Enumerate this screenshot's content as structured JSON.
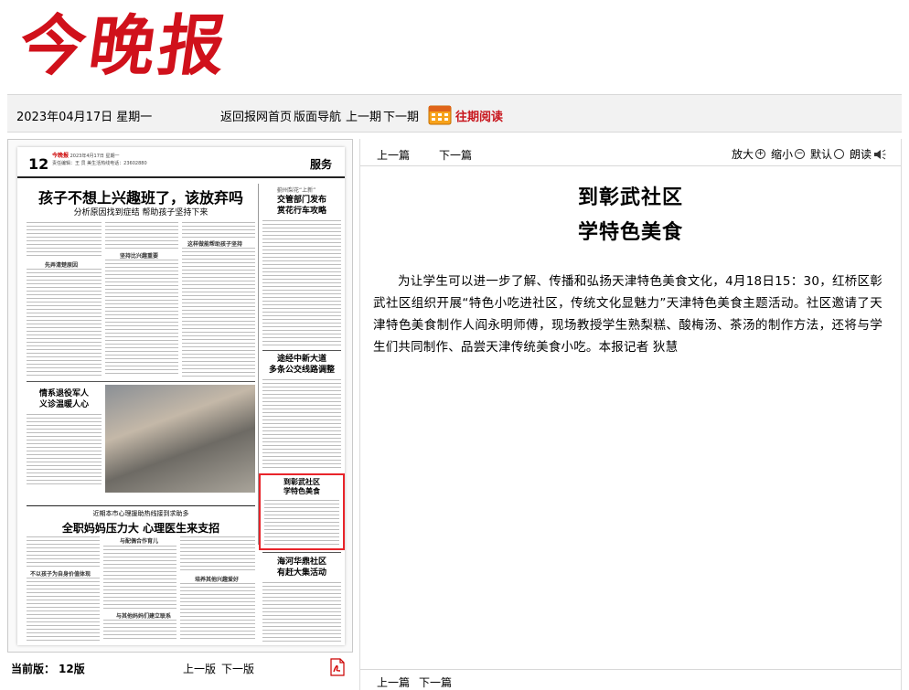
{
  "brand": {
    "logo_text": "今晚报",
    "color": "#d0111b"
  },
  "toolbar": {
    "date": "2023年04月17日 星期一",
    "nav": [
      "返回报网首页",
      "版面导航",
      "上一期",
      "下一期"
    ],
    "past_label": "往期阅读",
    "accent": "#c8171e"
  },
  "page_thumb": {
    "page_number": "12",
    "masthead_mini": "今晚报",
    "meta_line1": "2023年4月17日 星期一",
    "meta_line2": "责任编辑：王    员    美生活热线电话：23602880",
    "section": "服务",
    "headline": "孩子不想上兴趣班了，该放弃吗",
    "subhead": "分析原因找到症结  帮助孩子坚持下来",
    "side_top_kicker": "蓟州梨花“上新”",
    "side_top_title": "交管部门发布\n赏花行车攻略",
    "side_mid_title": "途经中新大道\n多条公交线路调整",
    "left_photo_title": "情系退役军人\n义诊温暖人心",
    "mini_heads": [
      "先弄清楚原因",
      "坚持比兴趣重要",
      "这样做能帮助孩子坚持"
    ],
    "highlight_title": "到彰武社区\n学特色美食",
    "side_bottom_title": "海河华鼎社区\n有赶大集活动",
    "bottom_kicker": "近期本市心理援助热线接到求助多",
    "bottom_headline": "全职妈妈压力大  心理医生来支招",
    "bottom_mini_heads": [
      "不以孩子为自身价值体现",
      "与配偶合作育儿",
      "培养其他兴趣爱好",
      "与其他妈妈们建立联系"
    ]
  },
  "bottom_left": {
    "current_label": "当前版：",
    "edition": "12版",
    "prev": "上一版",
    "next": "下一版"
  },
  "article_bar": {
    "prev": "上一篇",
    "next": "下一篇",
    "zoom_in": "放大",
    "zoom_out": "缩小",
    "default": "默认",
    "read_aloud": "朗读"
  },
  "article": {
    "title_line1": "到彰武社区",
    "title_line2": "学特色美食",
    "body": "为让学生可以进一步了解、传播和弘扬天津特色美食文化，4月18日15：30，红桥区彰武社区组织开展“特色小吃进社区，传统文化显魅力”天津特色美食主题活动。社区邀请了天津特色美食制作人阎永明师傅，现场教授学生熟梨糕、酸梅汤、茶汤的制作方法，还将与学生们共同制作、品尝天津传统美食小吃。本报记者  狄慧"
  },
  "article_bottom": {
    "prev": "上一篇",
    "next": "下一篇"
  }
}
